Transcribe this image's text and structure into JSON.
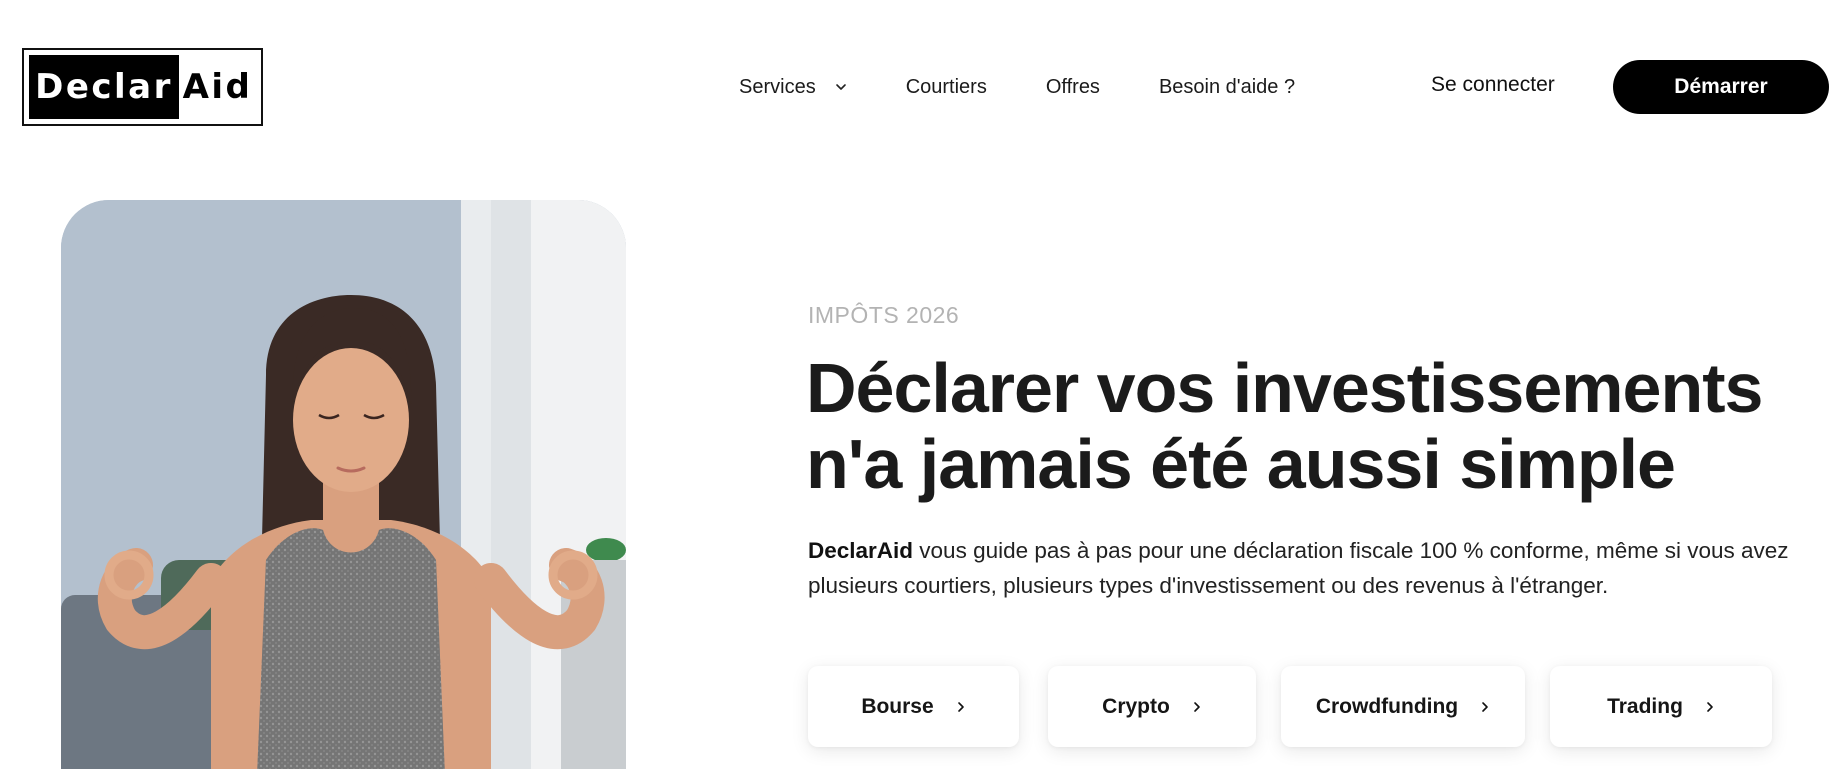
{
  "brand": {
    "logo_left": "Declar",
    "logo_right": "Aid"
  },
  "nav": {
    "items": [
      {
        "label": "Services",
        "has_dropdown": true
      },
      {
        "label": "Courtiers"
      },
      {
        "label": "Offres"
      },
      {
        "label": "Besoin d'aide ?"
      }
    ],
    "login_label": "Se connecter",
    "start_label": "Démarrer"
  },
  "hero": {
    "eyebrow": "IMPÔTS 2026",
    "headline_line1": "Déclarer vos investissements",
    "headline_line2": "n'a jamais été aussi simple",
    "desc_brand": "DeclarAid",
    "desc_rest": " vous guide pas à pas pour une déclaration fiscale 100 % conforme, même si vous avez plusieurs courtiers, plusieurs types d'investissement ou des revenus à l'étranger.",
    "categories": [
      {
        "label": "Bourse"
      },
      {
        "label": "Crypto"
      },
      {
        "label": "Crowdfunding"
      },
      {
        "label": "Trading"
      }
    ]
  },
  "colors": {
    "primary": "#000000",
    "text": "#1b1b1b",
    "eyebrow": "#b3b3b3",
    "background": "#ffffff"
  },
  "icons": {
    "dropdown": "chevron-down-icon",
    "category_arrow": "chevron-right-icon"
  }
}
